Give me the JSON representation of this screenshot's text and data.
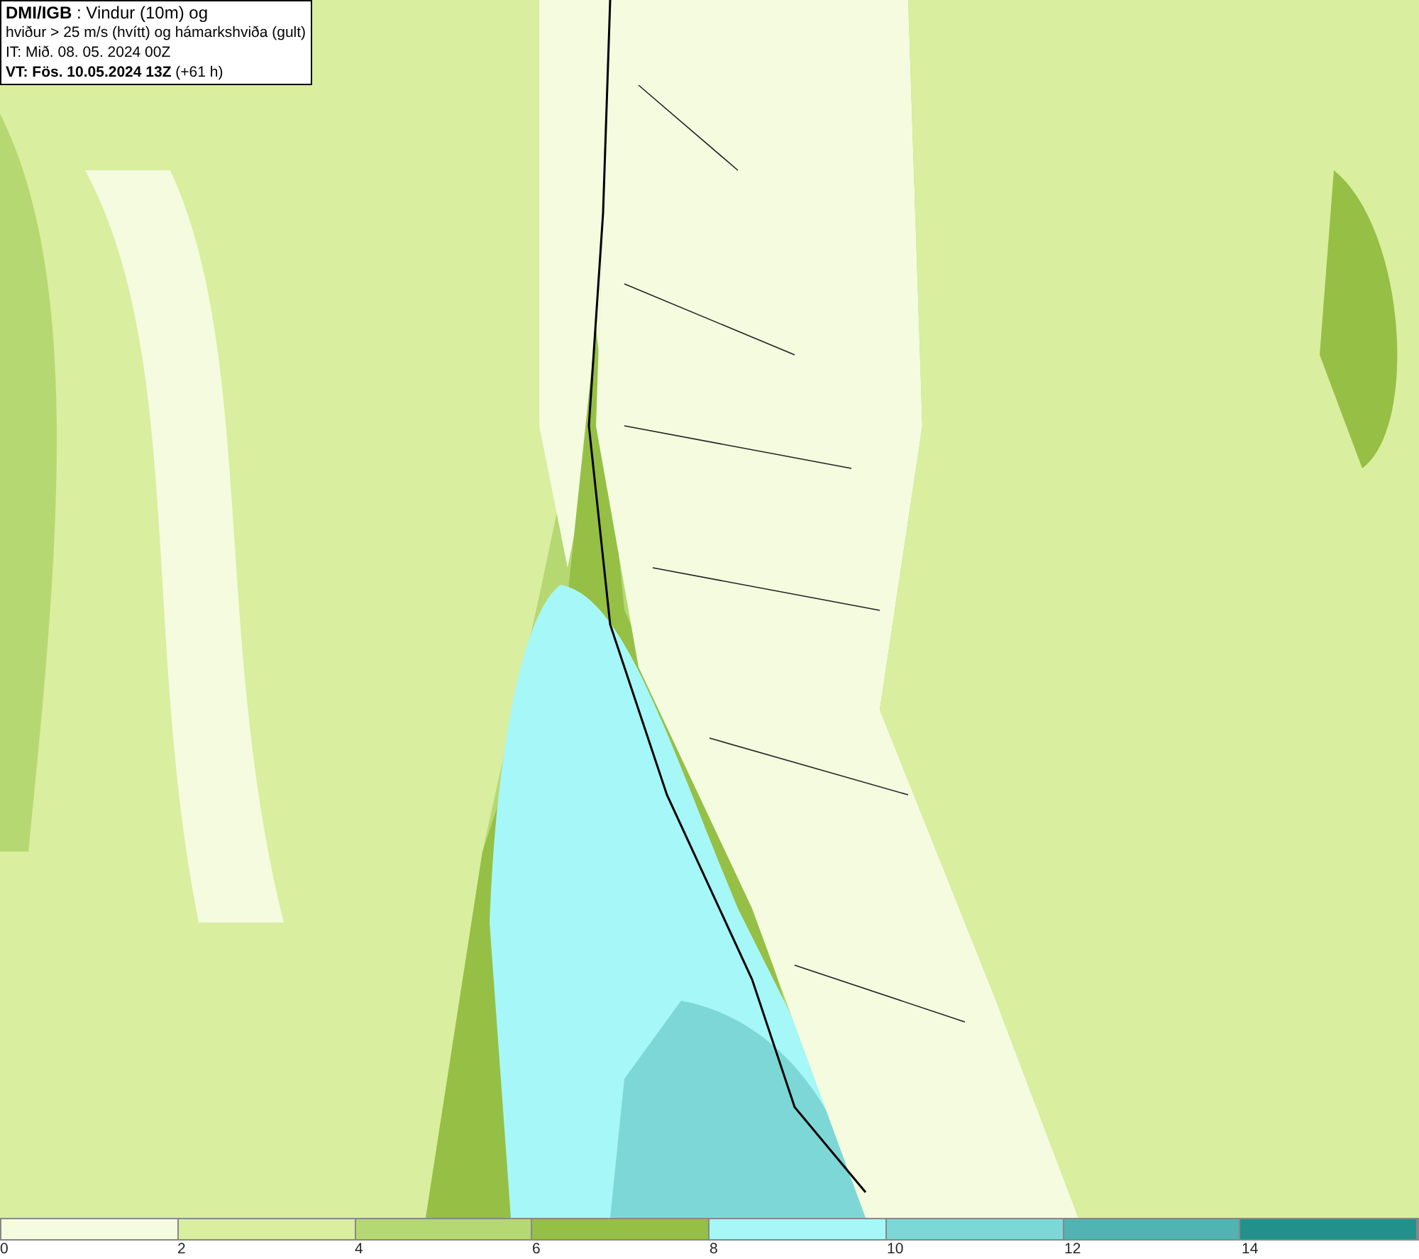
{
  "info_box": {
    "lines": [
      "**DMI/IGB** : Vindur (10m) og",
      "hviður > 25 m/s (hvítt) og hámarkshviða (gult)",
      "IT: Mið. 08. 05. 2024 00Z",
      "**VT: Fös. 10.05.2024 13Z** (+61 h)"
    ]
  },
  "legend": [
    {
      "color": "#f4fbdf",
      "label": "0"
    },
    {
      "color": "#d9ee9f",
      "label": "2"
    },
    {
      "color": "#b6d872",
      "label": "4"
    },
    {
      "color": "#96bf45",
      "label": "6"
    },
    {
      "color": "#a6f7f7",
      "label": "8"
    },
    {
      "color": "#7ed7d7",
      "label": "10"
    },
    {
      "color": "#52b3b3",
      "label": "12"
    },
    {
      "color": "#22918b",
      "label": "14"
    }
  ]
}
